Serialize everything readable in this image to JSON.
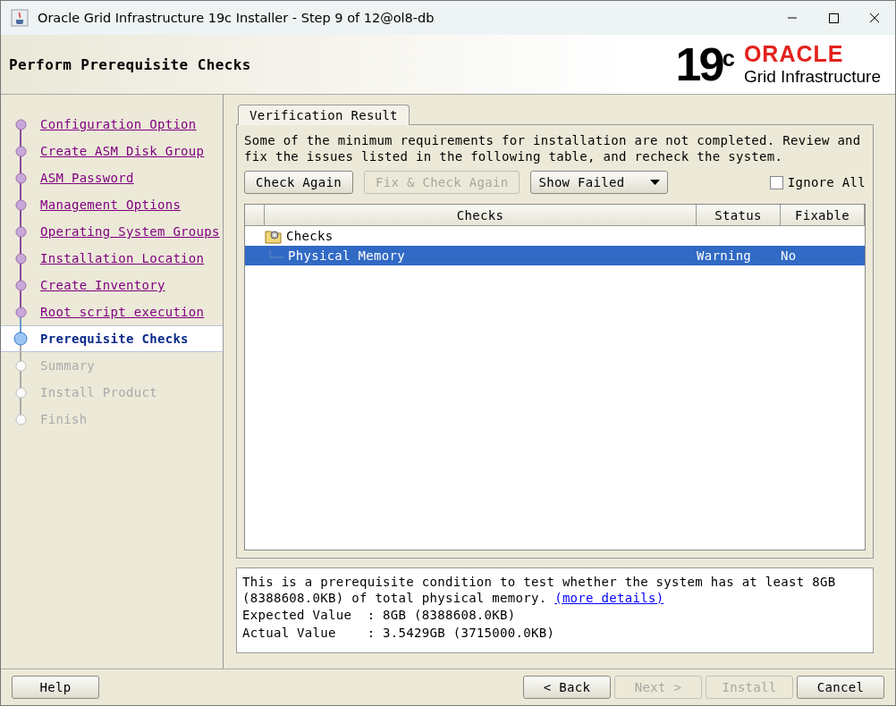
{
  "window": {
    "title": "Oracle Grid Infrastructure 19c Installer - Step 9 of 12@ol8-db"
  },
  "header": {
    "title": "Perform Prerequisite Checks",
    "logo_version": "19",
    "logo_sup": "c",
    "logo_brand": "ORACLE",
    "logo_product": "Grid Infrastructure"
  },
  "steps": [
    {
      "label": "Configuration Option",
      "completed": true,
      "selected": false
    },
    {
      "label": "Create ASM Disk Group",
      "completed": true,
      "selected": false
    },
    {
      "label": "ASM Password",
      "completed": true,
      "selected": false
    },
    {
      "label": "Management Options",
      "completed": true,
      "selected": false
    },
    {
      "label": "Operating System Groups",
      "completed": true,
      "selected": false
    },
    {
      "label": "Installation Location",
      "completed": true,
      "selected": false
    },
    {
      "label": "Create Inventory",
      "completed": true,
      "selected": false
    },
    {
      "label": "Root script execution",
      "completed": true,
      "selected": false
    },
    {
      "label": "Prerequisite Checks",
      "completed": false,
      "selected": true
    },
    {
      "label": "Summary",
      "completed": false,
      "selected": false
    },
    {
      "label": "Install Product",
      "completed": false,
      "selected": false
    },
    {
      "label": "Finish",
      "completed": false,
      "selected": false
    }
  ],
  "tabs": [
    {
      "label": "Verification Result",
      "selected": true
    }
  ],
  "message": "Some of the minimum requirements for installation are not completed. Review and fix the issues listed in the following table, and recheck the system.",
  "toolbar": {
    "buttons": [
      {
        "label": "Check Again",
        "disabled": false
      },
      {
        "label": "Fix & Check Again",
        "disabled": true
      }
    ],
    "filter": {
      "value": "Show Failed"
    },
    "ignore_all": {
      "label": "Ignore All",
      "checked": false
    }
  },
  "table": {
    "columns": [
      "Checks",
      "Status",
      "Fixable"
    ],
    "rows": [
      {
        "name": "Checks",
        "selected": false,
        "children": [
          {
            "name": "Physical Memory",
            "status": "Warning",
            "fixable": "No",
            "selected": true
          }
        ]
      }
    ]
  },
  "details": {
    "text": "This is a prerequisite condition to test whether the system has at least 8GB (8388608.0KB) of total physical memory.",
    "link": "(more details)",
    "lines": [
      "Expected Value  : 8GB (8388608.0KB)",
      "Actual Value    : 3.5429GB (3715000.0KB)"
    ]
  },
  "footer": {
    "left_buttons": [
      {
        "label": "Help",
        "disabled": false
      }
    ],
    "right_buttons": [
      {
        "label": "< Back",
        "disabled": false
      },
      {
        "label": "Next >",
        "disabled": true
      },
      {
        "label": "Install",
        "disabled": true
      },
      {
        "label": "Cancel",
        "disabled": false
      }
    ]
  }
}
